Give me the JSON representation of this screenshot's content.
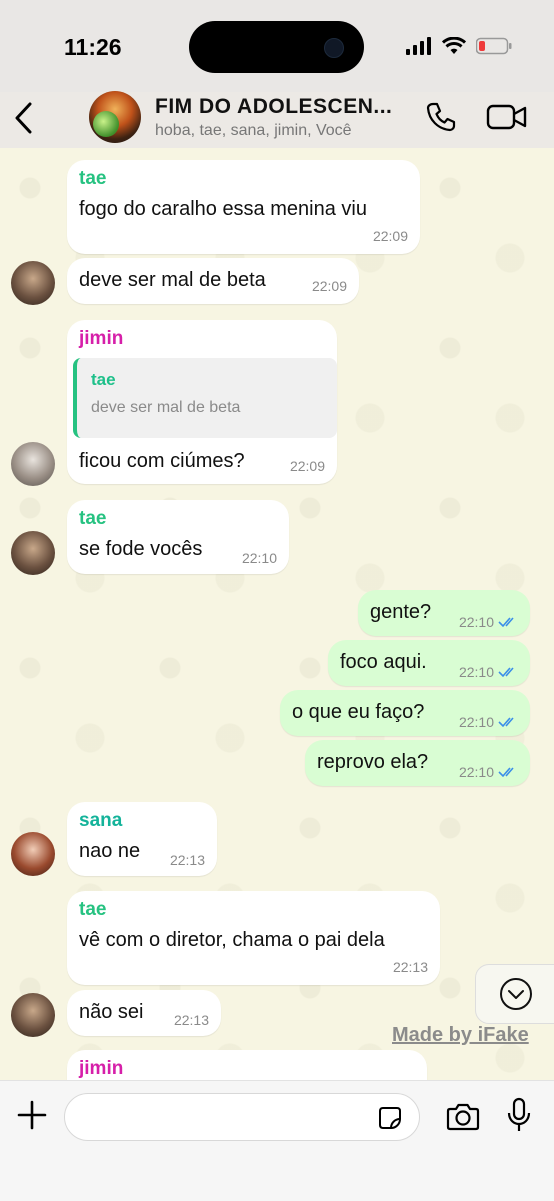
{
  "status_bar": {
    "time": "11:26"
  },
  "header": {
    "title": "FIM DO ADOLESCEN...",
    "subtitle": "hoba, tae, sana, jimin, Você"
  },
  "colors": {
    "tae": "#26c281",
    "jimin": "#d61fa9",
    "sana": "#14b39a",
    "outgoing": "#d9fdd3",
    "ticks": "#3b8ee8"
  },
  "messages": [
    {
      "sender": "tae",
      "text": "fogo do caralho essa menina viu",
      "time": "22:09",
      "direction": "in"
    },
    {
      "sender": "",
      "text": "deve ser mal de beta",
      "time": "22:09",
      "direction": "in"
    },
    {
      "sender": "jimin",
      "quote_sender": "tae",
      "quote_text": "deve ser mal de beta",
      "text": "ficou com ciúmes?",
      "time": "22:09",
      "direction": "in"
    },
    {
      "sender": "tae",
      "text": "se fode vocês",
      "time": "22:10",
      "direction": "in"
    },
    {
      "sender": "",
      "text": "gente?",
      "time": "22:10",
      "direction": "out"
    },
    {
      "sender": "",
      "text": "foco aqui.",
      "time": "22:10",
      "direction": "out"
    },
    {
      "sender": "",
      "text": "o que eu faço?",
      "time": "22:10",
      "direction": "out"
    },
    {
      "sender": "",
      "text": "reprovo ela?",
      "time": "22:10",
      "direction": "out"
    },
    {
      "sender": "sana",
      "text": "nao ne",
      "time": "22:13",
      "direction": "in"
    },
    {
      "sender": "tae",
      "text": "vê com o diretor, chama o pai dela",
      "time": "22:13",
      "direction": "in"
    },
    {
      "sender": "",
      "text": "não sei",
      "time": "22:13",
      "direction": "in"
    },
    {
      "sender": "jimin",
      "text": "",
      "time": "",
      "direction": "in"
    }
  ],
  "watermark": "Made by iFake",
  "icons": [
    "back-chevron-icon",
    "phone-icon",
    "video-call-icon",
    "chevron-down-icon",
    "plus-icon",
    "sticker-icon",
    "camera-icon",
    "microphone-icon",
    "read-ticks-icon"
  ]
}
